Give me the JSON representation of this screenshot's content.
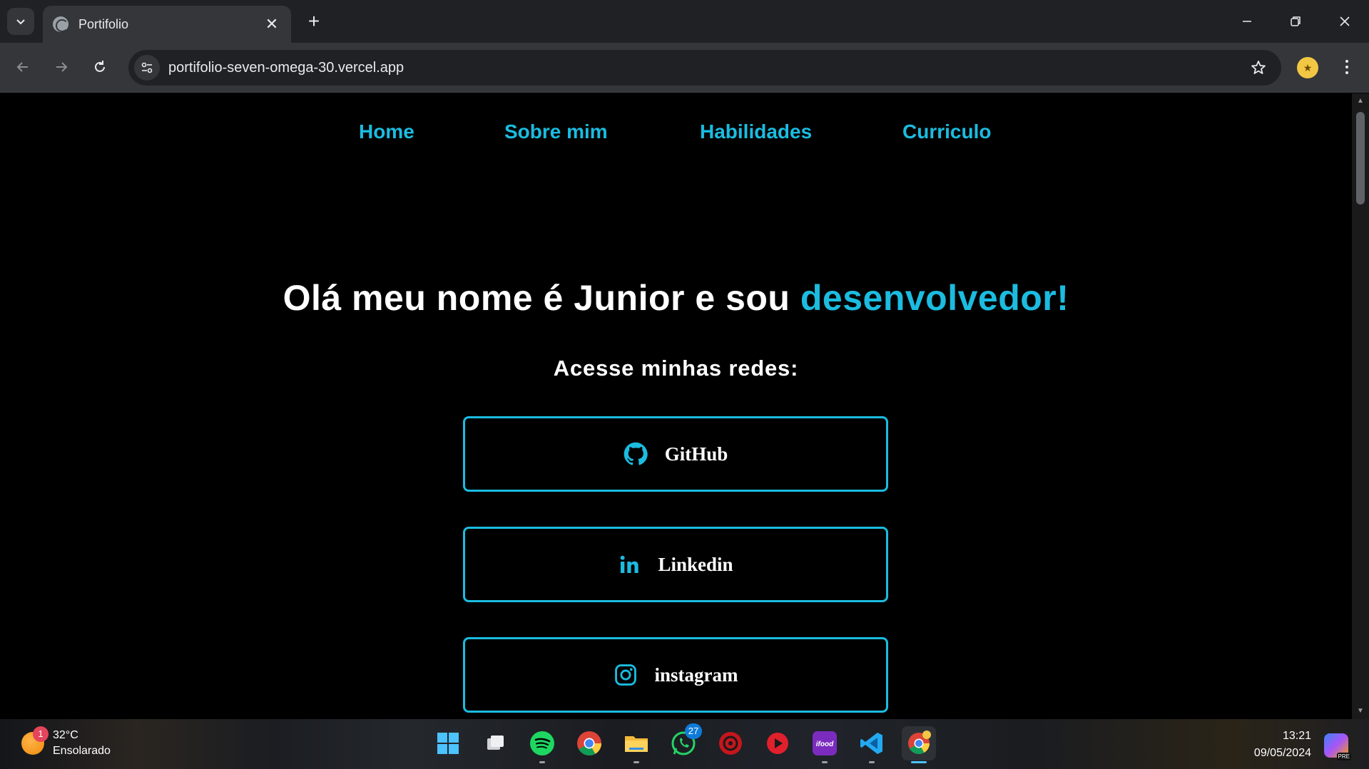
{
  "browser": {
    "tab_title": "Portifolio",
    "url": "portifolio-seven-omega-30.vercel.app"
  },
  "nav": {
    "items": [
      "Home",
      "Sobre mim",
      "Habilidades",
      "Curriculo"
    ]
  },
  "hero": {
    "headline_main": "Olá meu nome é Junior e sou ",
    "headline_accent": "desenvolvedor!",
    "subtitle": "Acesse minhas redes:"
  },
  "socials": [
    {
      "label": "GitHub",
      "icon": "github-icon"
    },
    {
      "label": "Linkedin",
      "icon": "linkedin-icon"
    },
    {
      "label": "instagram",
      "icon": "instagram-icon"
    }
  ],
  "taskbar": {
    "weather_temp": "32°C",
    "weather_desc": "Ensolarado",
    "weather_badge": "1",
    "whatsapp_badge": "27",
    "time": "13:21",
    "date": "09/05/2024",
    "copilot_badge": "PRE"
  },
  "colors": {
    "accent": "#1bbce0",
    "background": "#000000",
    "chrome_dark": "#202124",
    "chrome_mid": "#35363a"
  }
}
